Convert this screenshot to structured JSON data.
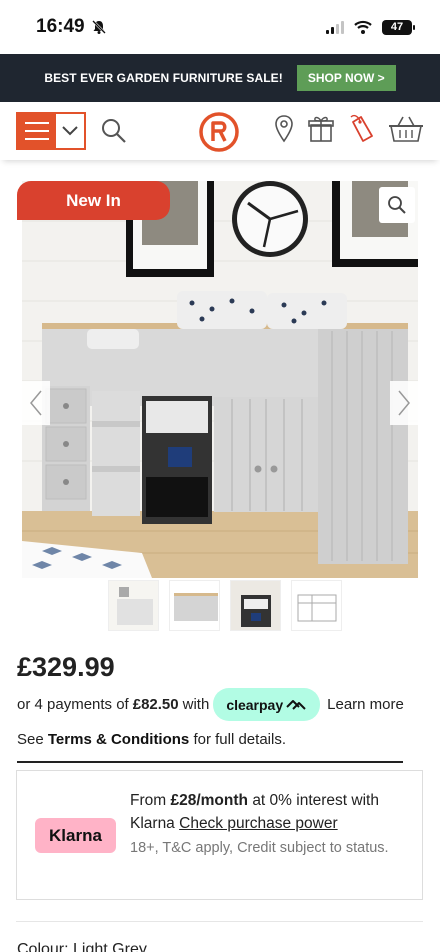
{
  "status_bar": {
    "time": "16:49",
    "battery": "47"
  },
  "promo": {
    "text": "BEST EVER GARDEN FURNITURE SALE!",
    "button": "SHOP NOW >"
  },
  "header": {
    "logo_icon": "robert-dyas-logo-icon"
  },
  "product": {
    "badge": "New In",
    "price": "£329.99",
    "payments_prefix": "or 4 payments of",
    "payments_amount": "£82.50",
    "payments_with": "with",
    "clearpay_label": "clearpay",
    "learn_more": "Learn more",
    "terms_prefix": "See",
    "terms_link": "Terms & Conditions",
    "terms_suffix": "for full details.",
    "colour_label": "Colour: Light Grey"
  },
  "klarna": {
    "logo": "Klarna",
    "from": "From",
    "amount": "£28/month",
    "interest": "at 0% interest with",
    "brand": "Klarna",
    "link": "Check purchase power",
    "fine_print": "18+, T&C apply, Credit subject to status."
  },
  "colors": {
    "accent": "#e2522a",
    "promo_bg": "#1f2630",
    "promo_button": "#5e9d57",
    "badge": "#d9412e",
    "clearpay": "#b2fce4",
    "klarna": "#ffb3c7"
  }
}
